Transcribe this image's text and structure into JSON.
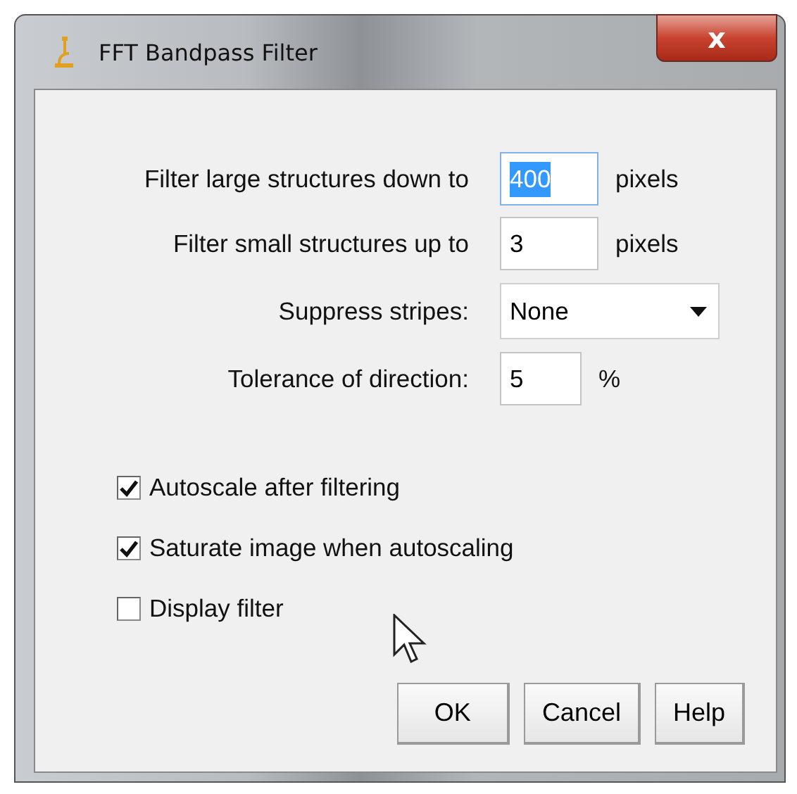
{
  "window": {
    "title": "FFT Bandpass Filter",
    "close": "x"
  },
  "fields": [
    {
      "kind": "text",
      "label": "Filter large structures down to",
      "value": "400",
      "highlighted": true,
      "unit": "pixels"
    },
    {
      "kind": "text",
      "label": "Filter small structures up to",
      "value": "3",
      "highlighted": false,
      "unit": "pixels"
    },
    {
      "kind": "dropdown",
      "label": "Suppress stripes:",
      "value": "None"
    },
    {
      "kind": "short",
      "label": "Tolerance of direction:",
      "value": "5",
      "highlighted": false,
      "unit": "%"
    }
  ],
  "checkboxes": [
    {
      "label": "Autoscale after filtering",
      "checked": true
    },
    {
      "label": "Saturate image when autoscaling",
      "checked": true
    },
    {
      "label": "Display filter",
      "checked": false
    }
  ],
  "buttons": [
    "OK",
    "Cancel",
    "Help"
  ]
}
